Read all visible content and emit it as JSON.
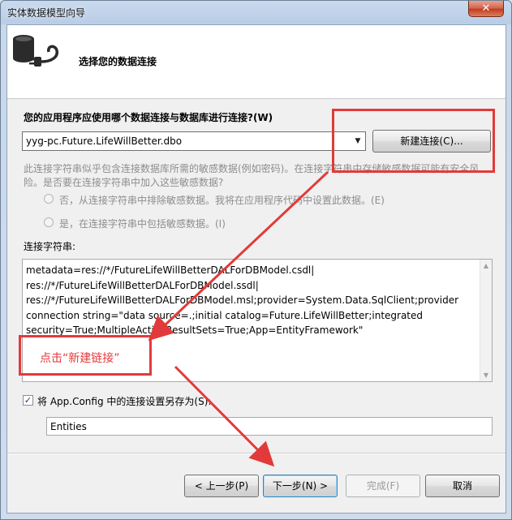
{
  "window": {
    "title": "实体数据模型向导",
    "close_symbol": "✕"
  },
  "header": {
    "title": "选择您的数据连接",
    "icon": "database-plug-icon"
  },
  "connection": {
    "question_label": "您的应用程序应使用哪个数据连接与数据库进行连接?(W)",
    "selected_value": "yyg-pc.Future.LifeWillBetter.dbo",
    "new_connection_button": "新建连接(C)..."
  },
  "sensitive": {
    "warning_line1": "此连接字符串似乎包含连接数据库所需的敏感数据(例如密码)。在连接字符串中存储敏感数据可能有安全风",
    "warning_line2": "险。是否要在连接字符串中加入这些敏感数据?",
    "option_exclude": "否，从连接字符串中排除敏感数据。我将在应用程序代码中设置此数据。(E)",
    "option_include": "是，在连接字符串中包括敏感数据。(I)"
  },
  "connection_string": {
    "label": "连接字符串:",
    "lines": [
      "metadata=res://*/FutureLifeWillBetterDALForDBModel.csdl|",
      "res://*/FutureLifeWillBetterDALForDBModel.ssdl|",
      "res://*/FutureLifeWillBetterDALForDBModel.msl;provider=System.Data.SqlClient;provider",
      "connection string=\"data source=.;initial catalog=Future.LifeWillBetter;integrated",
      "security=True;MultipleActiveResultSets=True;App=EntityFramework\""
    ]
  },
  "save": {
    "checked": true,
    "label": "将 App.Config 中的连接设置另存为(S):",
    "entity_name": "Entities"
  },
  "buttons": {
    "prev": "< 上一步(P)",
    "next": "下一步(N) >",
    "finish": "完成(F)",
    "cancel": "取消"
  },
  "annotation": {
    "text": "点击“新建链接”",
    "color": "#e23a3a"
  }
}
